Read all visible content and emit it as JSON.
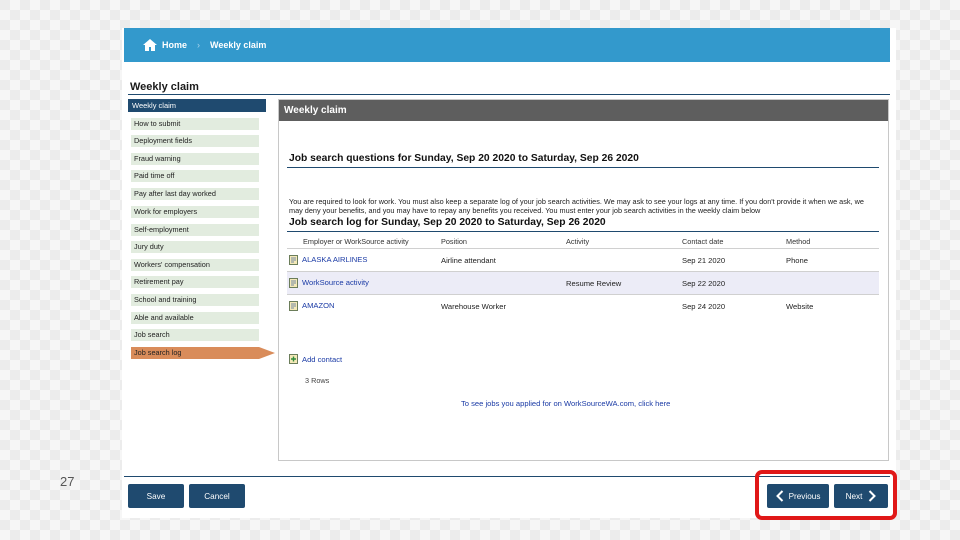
{
  "breadcrumb": {
    "home": "Home",
    "separator": "›",
    "current": "Weekly claim"
  },
  "page_title": "Weekly claim",
  "sidebar": {
    "header": "Weekly claim",
    "items": [
      {
        "label": "How to submit",
        "active": false
      },
      {
        "label": "Deployment fields",
        "active": false
      },
      {
        "label": "Fraud warning",
        "active": false
      },
      {
        "label": "Paid time off",
        "active": false
      },
      {
        "label": "Pay after last day worked",
        "active": false
      },
      {
        "label": "Work for employers",
        "active": false
      },
      {
        "label": "Self-employment",
        "active": false
      },
      {
        "label": "Jury duty",
        "active": false
      },
      {
        "label": "Workers' compensation",
        "active": false
      },
      {
        "label": "Retirement pay",
        "active": false
      },
      {
        "label": "School and training",
        "active": false
      },
      {
        "label": "Able and available",
        "active": false
      },
      {
        "label": "Job search",
        "active": false
      },
      {
        "label": "Job search log",
        "active": true
      }
    ]
  },
  "panel": {
    "header": "Weekly claim",
    "questions_title": "Job search questions for Sunday, Sep 20 2020 to Saturday, Sep 26 2020",
    "notice": "You are required to look for work. You must also keep a separate log of your job search activities. We may ask to see your logs at any time. If you don't provide it when we ask, we may deny your benefits, and you may have to repay any benefits you received. You must enter your job search activities in the weekly claim below",
    "log_title": "Job search log for Sunday, Sep 20 2020 to Saturday, Sep 26 2020",
    "columns": [
      "Employer or WorkSource activity",
      "Position",
      "Activity",
      "Contact date",
      "Method"
    ],
    "rows": [
      {
        "employer": "ALASKA AIRLINES",
        "position": "Airline attendant",
        "activity": "",
        "contact_date": "Sep 21 2020",
        "method": "Phone"
      },
      {
        "employer": "WorkSource activity",
        "position": "",
        "activity": "Resume Review",
        "contact_date": "Sep 22 2020",
        "method": ""
      },
      {
        "employer": "AMAZON",
        "position": "Warehouse Worker",
        "activity": "",
        "contact_date": "Sep 24 2020",
        "method": "Website"
      }
    ],
    "add_contact": "Add contact",
    "rows_count": "3 Rows",
    "applied_link": "To see jobs you applied for on WorkSourceWA.com, click here"
  },
  "buttons": {
    "save": "Save",
    "cancel": "Cancel",
    "previous": "Previous",
    "next": "Next"
  },
  "slide_number": "27",
  "colors": {
    "topbar": "#3399cc",
    "navy": "#1f4a6f",
    "active_item": "#d98c5a",
    "highlight": "#e01818"
  },
  "icons": [
    "home-icon",
    "contact-doc-icon",
    "add-contact-icon",
    "chevron-left-icon",
    "chevron-right-icon"
  ]
}
